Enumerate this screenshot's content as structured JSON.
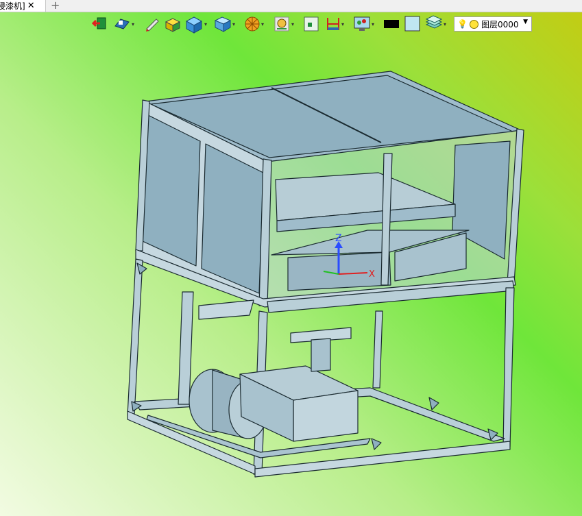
{
  "tab": {
    "title": "浸漆机]",
    "close_glyph": "✕",
    "new_tab_glyph": "+"
  },
  "toolbar": {
    "buttons": [
      {
        "name": "exit-icon",
        "dropdown": false
      },
      {
        "name": "view-icon",
        "dropdown": true
      },
      {
        "name": "pen-icon",
        "dropdown": false
      },
      {
        "name": "cube-yellow-icon",
        "dropdown": false
      },
      {
        "name": "cube-blue-icon",
        "dropdown": true
      },
      {
        "name": "cube-view-icon",
        "dropdown": true
      },
      {
        "name": "section-icon",
        "dropdown": true
      },
      {
        "name": "zoom-icon",
        "dropdown": true
      },
      {
        "name": "frame-icon",
        "dropdown": false
      },
      {
        "name": "measure-icon",
        "dropdown": true
      },
      {
        "name": "display-icon",
        "dropdown": true
      },
      {
        "name": "black-color-icon",
        "dropdown": false
      },
      {
        "name": "light-color-icon",
        "dropdown": false
      },
      {
        "name": "layers-icon",
        "dropdown": true
      }
    ],
    "layer_label": "图层0000",
    "colors": {
      "black_swatch": "#000000",
      "light_swatch": "#bfe6f2"
    }
  },
  "axis": {
    "z_label": "Z",
    "x_label": "X",
    "z_color": "#2a4cff",
    "x_color": "#e02020"
  },
  "model": {
    "frame_color": "#b9cfd8",
    "panel_color": "#8fb0c0",
    "edge_color": "#1a2a30"
  }
}
